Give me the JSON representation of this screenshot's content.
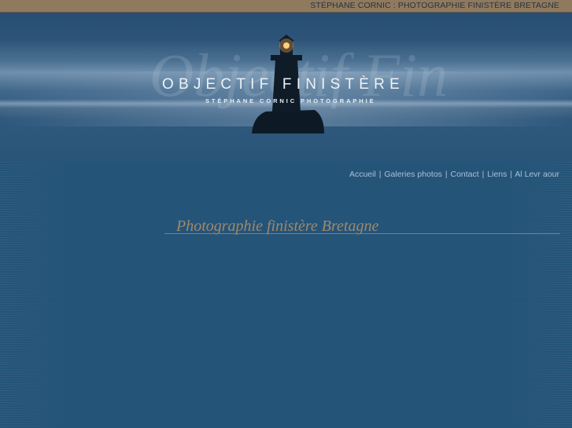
{
  "topbar": {
    "title": "STÉPHANE CORNIC : PHOTOGRAPHIE FINISTÈRE BRETAGNE"
  },
  "logo": {
    "main": "OBJECTIF  FINISTÈRE",
    "sub": "STÉPHANE CORNIC PHOTOGRAPHIE",
    "script_watermark": "Objectif Finistère",
    "icon": "lighthouse-icon"
  },
  "nav": {
    "items": [
      {
        "label": "Accueil"
      },
      {
        "label": "Galeries photos"
      },
      {
        "label": "Contact"
      },
      {
        "label": "Liens"
      },
      {
        "label": "Al Levr aour"
      }
    ],
    "separator": "|"
  },
  "main": {
    "headline": "Photographie finistère Bretagne"
  },
  "colors": {
    "background": "#255479",
    "topbar": "#8f7a5e",
    "nav_link": "#a7c0d6",
    "headline": "#9e8a6c",
    "logo_text": "#eef2f5"
  }
}
